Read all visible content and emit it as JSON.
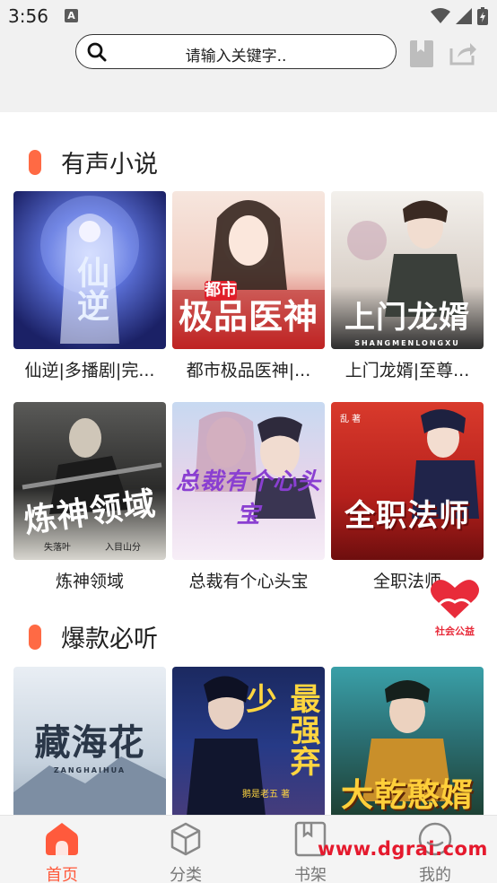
{
  "status_bar": {
    "time": "3:56",
    "notification_letter": "A"
  },
  "search": {
    "placeholder": "请输入关键字.."
  },
  "sections": [
    {
      "title": "有声小说",
      "books": [
        {
          "title": "仙逆|多播剧|完...",
          "cover_text": "仙逆"
        },
        {
          "title": "都市极品医神|...",
          "cover_text": "极品医神",
          "cover_badge": "都市",
          "cover_sub": "DUSHI JIPINYISHEN"
        },
        {
          "title": "上门龙婿|至尊...",
          "cover_text": "上门龙婿",
          "cover_sub": "SHANGMENLONGXU"
        },
        {
          "title": "炼神领域",
          "cover_text": "炼神领域",
          "cover_author_a": "失落叶",
          "cover_author_b": "入目山分"
        },
        {
          "title": "总裁有个心头宝",
          "cover_text": "总裁有个心头宝"
        },
        {
          "title": "全职法师",
          "cover_text": "全职法师",
          "cover_author": "乱 著"
        }
      ]
    },
    {
      "title": "爆款必听",
      "books": [
        {
          "cover_text": "藏海花",
          "cover_sub": "ZANGHAIHUA"
        },
        {
          "cover_text": "最强弃少",
          "cover_author": "鹅是老五 著"
        },
        {
          "cover_text": "大乾憨婿"
        }
      ]
    }
  ],
  "charity": {
    "label": "社会公益"
  },
  "nav": [
    {
      "label": "首页",
      "icon": "home-icon",
      "active": true
    },
    {
      "label": "分类",
      "icon": "cube-icon"
    },
    {
      "label": "书架",
      "icon": "bookshelf-icon"
    },
    {
      "label": "我的",
      "icon": "profile-icon"
    }
  ],
  "watermark": "www.dgrai.com",
  "colors": {
    "accent": "#ff5a3c",
    "section_bar": "#ff6a44",
    "charity": "#e82b3a"
  }
}
